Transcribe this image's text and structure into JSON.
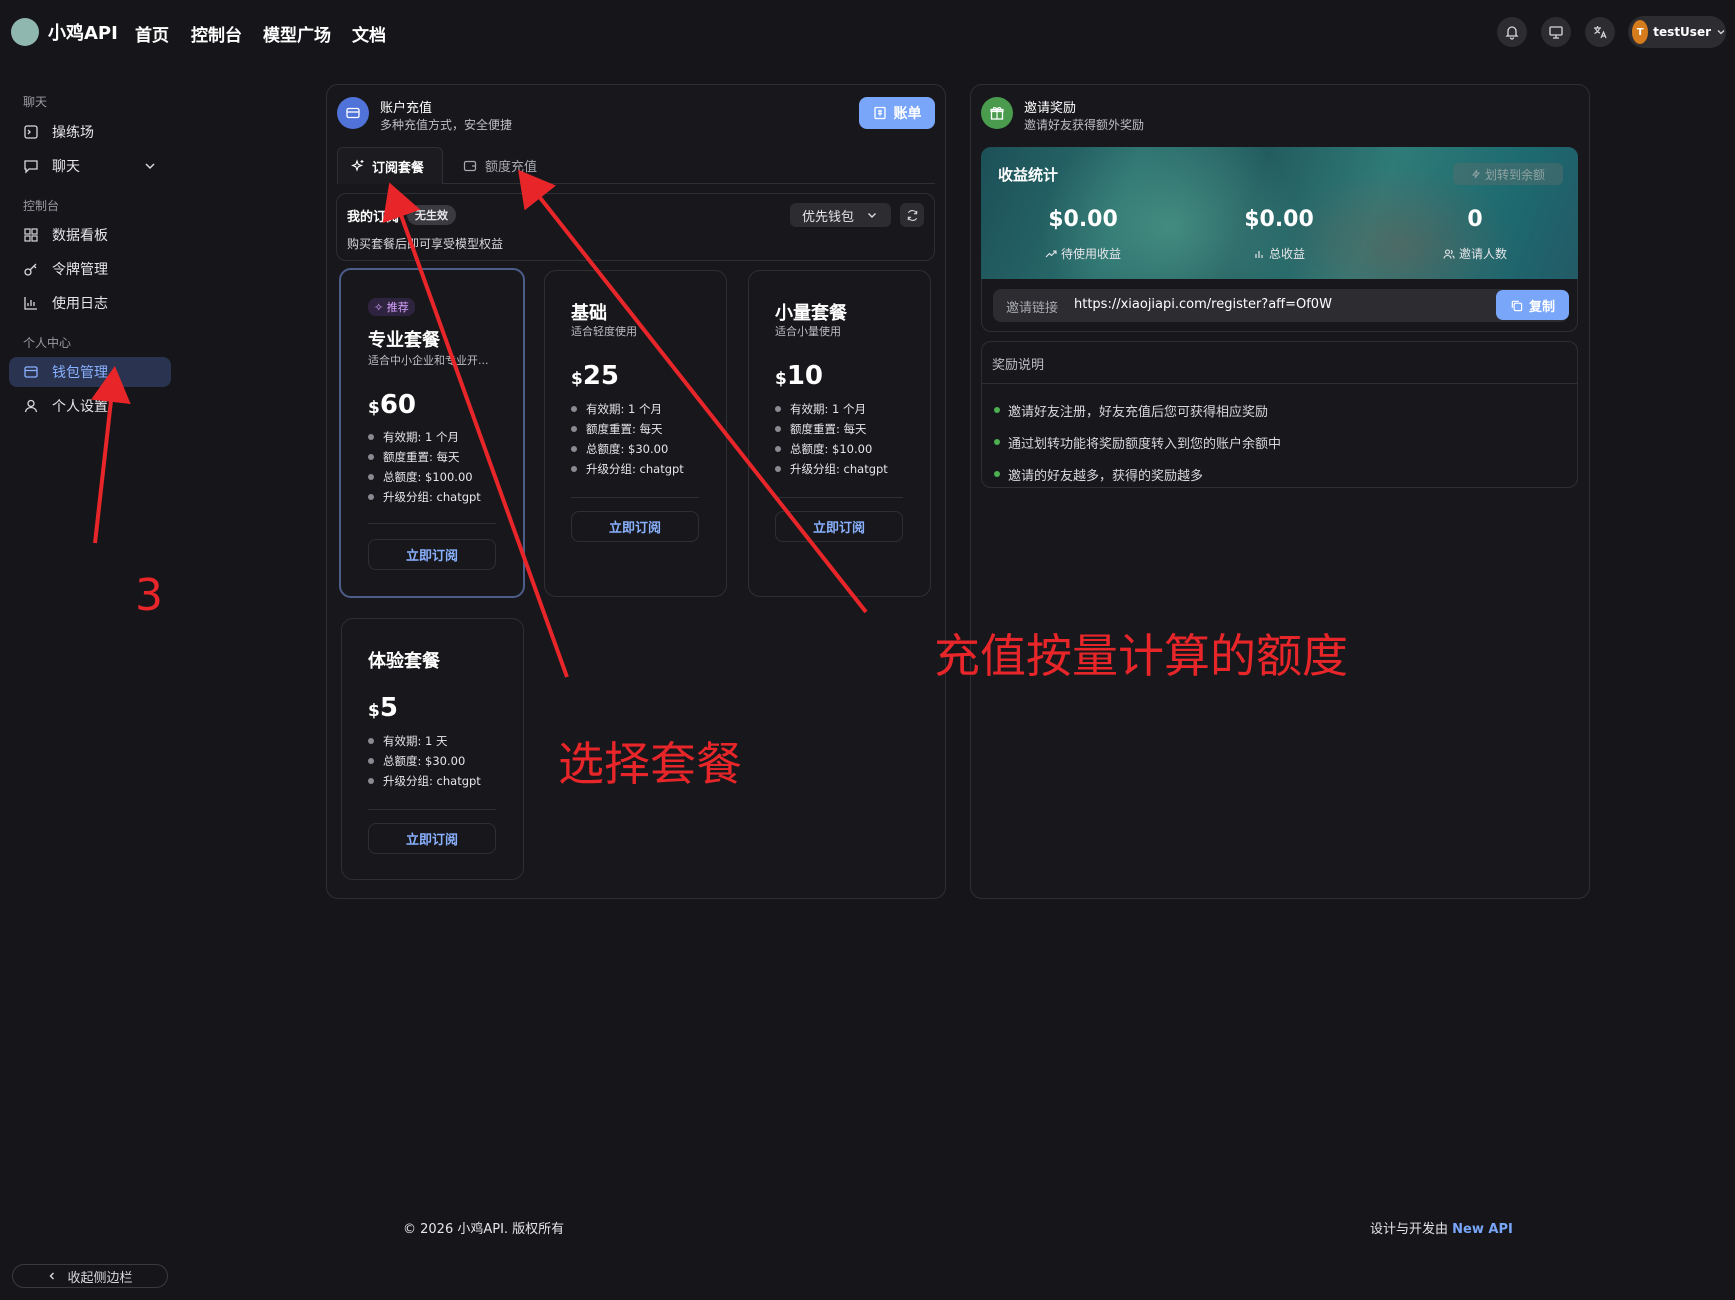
{
  "topbar": {
    "brand": "小鸡API",
    "nav": [
      "首页",
      "控制台",
      "模型广场",
      "文档"
    ],
    "icons": [
      "bell-icon",
      "monitor-icon",
      "translate-icon"
    ],
    "user": {
      "avatar_letter": "T",
      "name": "testUser"
    }
  },
  "sidebar": {
    "sections": [
      {
        "title": "聊天",
        "items": [
          {
            "label": "操练场",
            "icon": "playground-icon"
          },
          {
            "label": "聊天",
            "icon": "chat-icon",
            "expandable": true
          }
        ]
      },
      {
        "title": "控制台",
        "items": [
          {
            "label": "数据看板",
            "icon": "dashboard-icon"
          },
          {
            "label": "令牌管理",
            "icon": "key-icon"
          },
          {
            "label": "使用日志",
            "icon": "chart-icon"
          }
        ]
      },
      {
        "title": "个人中心",
        "items": [
          {
            "label": "钱包管理",
            "icon": "wallet-icon",
            "active": true
          },
          {
            "label": "个人设置",
            "icon": "user-icon"
          }
        ]
      }
    ],
    "collapse_label": "收起侧边栏"
  },
  "recharge": {
    "title": "账户充值",
    "subtitle": "多种充值方式，安全便捷",
    "bill_button": "账单",
    "tabs": [
      {
        "label": "订阅套餐",
        "active": true
      },
      {
        "label": "额度充值",
        "active": false
      }
    ],
    "my_sub": {
      "title": "我的订阅",
      "status_badge": "无生效",
      "desc": "购买套餐后即可享受模型权益",
      "wallet_select": "优先钱包"
    },
    "plans": [
      {
        "badge": "推荐",
        "name": "专业套餐",
        "desc": "适合中小企业和专业开...",
        "currency": "$",
        "price": "60",
        "features": [
          "有效期: 1 个月",
          "额度重置: 每天",
          "总额度: $100.00",
          "升级分组: chatgpt"
        ],
        "button": "立即订阅"
      },
      {
        "name": "基础",
        "desc": "适合轻度使用",
        "currency": "$",
        "price": "25",
        "features": [
          "有效期: 1 个月",
          "额度重置: 每天",
          "总额度: $30.00",
          "升级分组: chatgpt"
        ],
        "button": "立即订阅"
      },
      {
        "name": "小量套餐",
        "desc": "适合小量使用",
        "currency": "$",
        "price": "10",
        "features": [
          "有效期: 1 个月",
          "额度重置: 每天",
          "总额度: $10.00",
          "升级分组: chatgpt"
        ],
        "button": "立即订阅"
      },
      {
        "name": "体验套餐",
        "desc": "",
        "currency": "$",
        "price": "5",
        "features": [
          "有效期: 1 天",
          "总额度: $30.00",
          "升级分组: chatgpt"
        ],
        "button": "立即订阅"
      }
    ]
  },
  "invite": {
    "title": "邀请奖励",
    "subtitle": "邀请好友获得额外奖励",
    "earnings": {
      "title": "收益统计",
      "transfer_button": "划转到余额",
      "stats": [
        {
          "value": "$0.00",
          "label": "待使用收益",
          "icon": "trend-icon"
        },
        {
          "value": "$0.00",
          "label": "总收益",
          "icon": "bar-icon"
        },
        {
          "value": "0",
          "label": "邀请人数",
          "icon": "users-icon"
        }
      ]
    },
    "link_label": "邀请链接",
    "link_value": "https://xiaojiapi.com/register?aff=Of0W",
    "copy_button": "复制",
    "rules_title": "奖励说明",
    "rules": [
      "邀请好友注册，好友充值后您可获得相应奖励",
      "通过划转功能将奖励额度转入到您的账户余额中",
      "邀请的好友越多，获得的奖励越多"
    ]
  },
  "footer": {
    "copyright": "© 2026 小鸡API. 版权所有",
    "credit_prefix": "设计与开发由",
    "credit_link": "New API"
  },
  "annotations": {
    "step_number": "3",
    "select_plan": "选择套餐",
    "recharge_note": "充值按量计算的额度"
  },
  "colors": {
    "accent": "#79a6f8",
    "bg": "#16161a",
    "annotation": "#e8262a",
    "success": "#4caf50"
  }
}
